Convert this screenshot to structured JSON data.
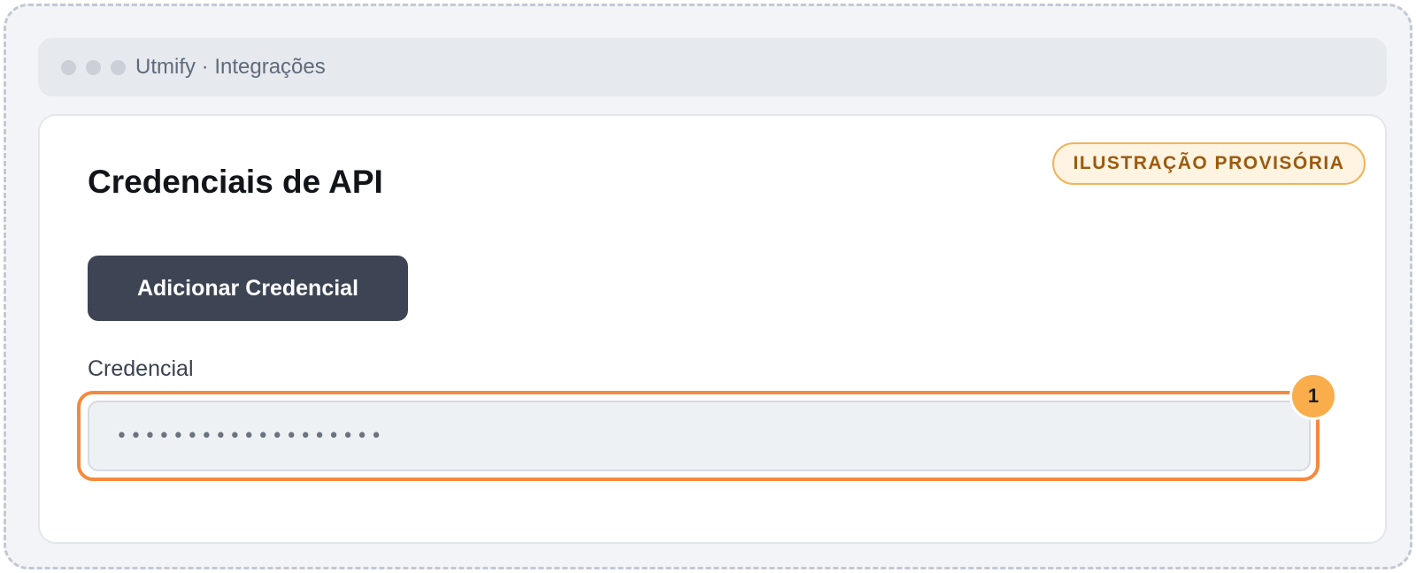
{
  "window": {
    "title": "Utmify · Integrações"
  },
  "badge": {
    "label": "ILUSTRAÇÃO PROVISÓRIA"
  },
  "card": {
    "title": "Credenciais de API",
    "add_button_label": "Adicionar Credencial",
    "field_label": "Credencial",
    "credential_value": "•••••••••••••••••••"
  },
  "annotation": {
    "step_number": "1"
  },
  "colors": {
    "highlight": "#f5893d",
    "marker": "#f9ad4b",
    "button": "#3d4554",
    "badge_text": "#9b5a0c"
  }
}
